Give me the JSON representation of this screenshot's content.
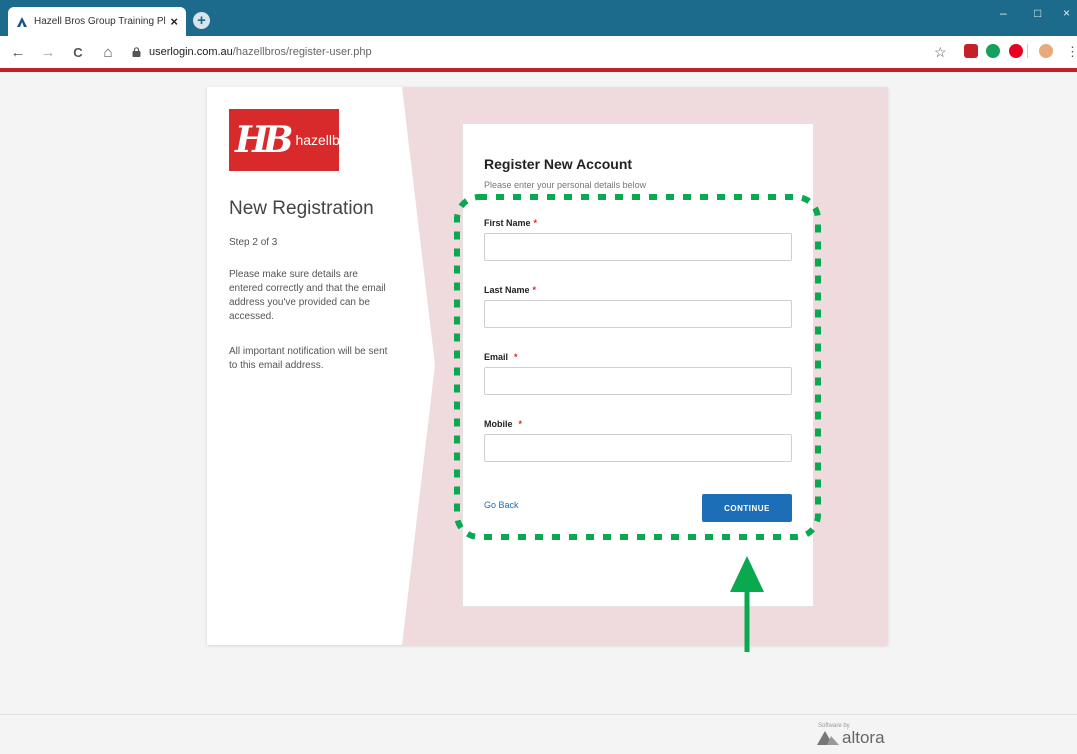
{
  "browser": {
    "tab_title": "Hazell Bros Group Training Platfo",
    "tab_close": "×",
    "new_tab": "+",
    "url_host": "userlogin.com.au",
    "url_path": "/hazellbros/register-user.php",
    "window_controls": [
      "–",
      "□",
      "×"
    ],
    "nav": {
      "back": "←",
      "forward": "→",
      "reload": "C",
      "home": "⌂"
    },
    "star": "☆",
    "menu": "⋮",
    "accent_color": "#1d6b8c",
    "extension_icons": [
      "pdf-icon",
      "grammarly-icon",
      "pinterest-icon",
      "profile-avatar"
    ]
  },
  "brand": {
    "logo_mark": "HB",
    "logo_text": "hazellbros",
    "logo_color": "#d82a2a"
  },
  "left_panel": {
    "title": "New Registration",
    "step": "Step 2 of 3",
    "paragraph1": "Please make sure details are entered correctly and that the email address you've provided can be accessed.",
    "paragraph2": "All important notification will be sent to this email address."
  },
  "form": {
    "title": "Register New Account",
    "subtitle": "Please enter your personal details below",
    "fields": [
      {
        "label": "First Name",
        "required": "*",
        "value": ""
      },
      {
        "label": "Last Name",
        "required": "*",
        "value": ""
      },
      {
        "label": "Email",
        "required": "*",
        "value": ""
      },
      {
        "label": "Mobile",
        "required": "*",
        "value": ""
      }
    ],
    "go_back": "Go Back",
    "continue": "CONTINUE",
    "button_color": "#1c6fb6"
  },
  "footer": {
    "small_text": "Software by",
    "brand": "altora"
  },
  "annotation": {
    "highlight_color": "#0aa84f",
    "shape": "dotted-rounded-rectangle",
    "arrow": "up-arrow"
  }
}
